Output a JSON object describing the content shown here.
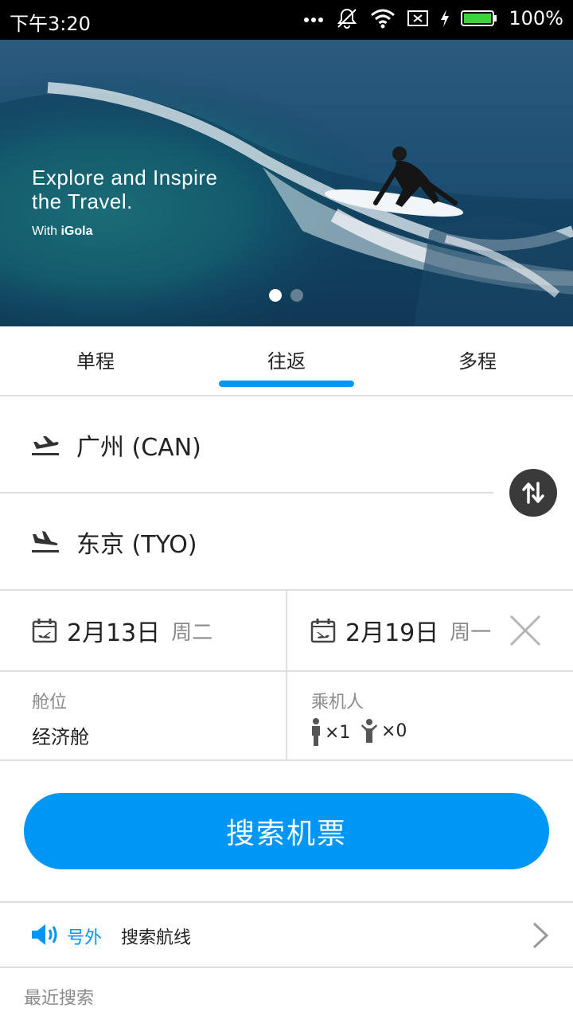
{
  "status_bar": {
    "time": "下午3:20",
    "battery": "100%",
    "icons": [
      "more-dots-icon",
      "mute-icon",
      "wifi-icon",
      "no-sim-icon",
      "charging-icon",
      "battery-icon"
    ]
  },
  "banner": {
    "title": "Explore and Inspire\nthe Travel.",
    "sub_prefix": "With ",
    "brand": "iGola",
    "slide_count": 2,
    "active_slide": 1
  },
  "tabs": [
    {
      "label": "单程",
      "active": false
    },
    {
      "label": "往返",
      "active": true
    },
    {
      "label": "多程",
      "active": false
    }
  ],
  "route": {
    "from": "广州 (CAN)",
    "to": "东京 (TYO)"
  },
  "dates": {
    "depart_date": "2月13日",
    "depart_weekday": "周二",
    "return_date": "2月19日",
    "return_weekday": "周一"
  },
  "cabin": {
    "label": "舱位",
    "value": "经济舱"
  },
  "passengers": {
    "label": "乘机人",
    "adults": "×1",
    "children": "×0"
  },
  "search_button": "搜索机票",
  "notice": {
    "tag": "号外",
    "text": "搜索航线"
  },
  "recent_label": "最近搜索",
  "colors": {
    "accent": "#0096f5",
    "divider": "#e0e0e0",
    "muted_text": "#8a8a8a"
  }
}
